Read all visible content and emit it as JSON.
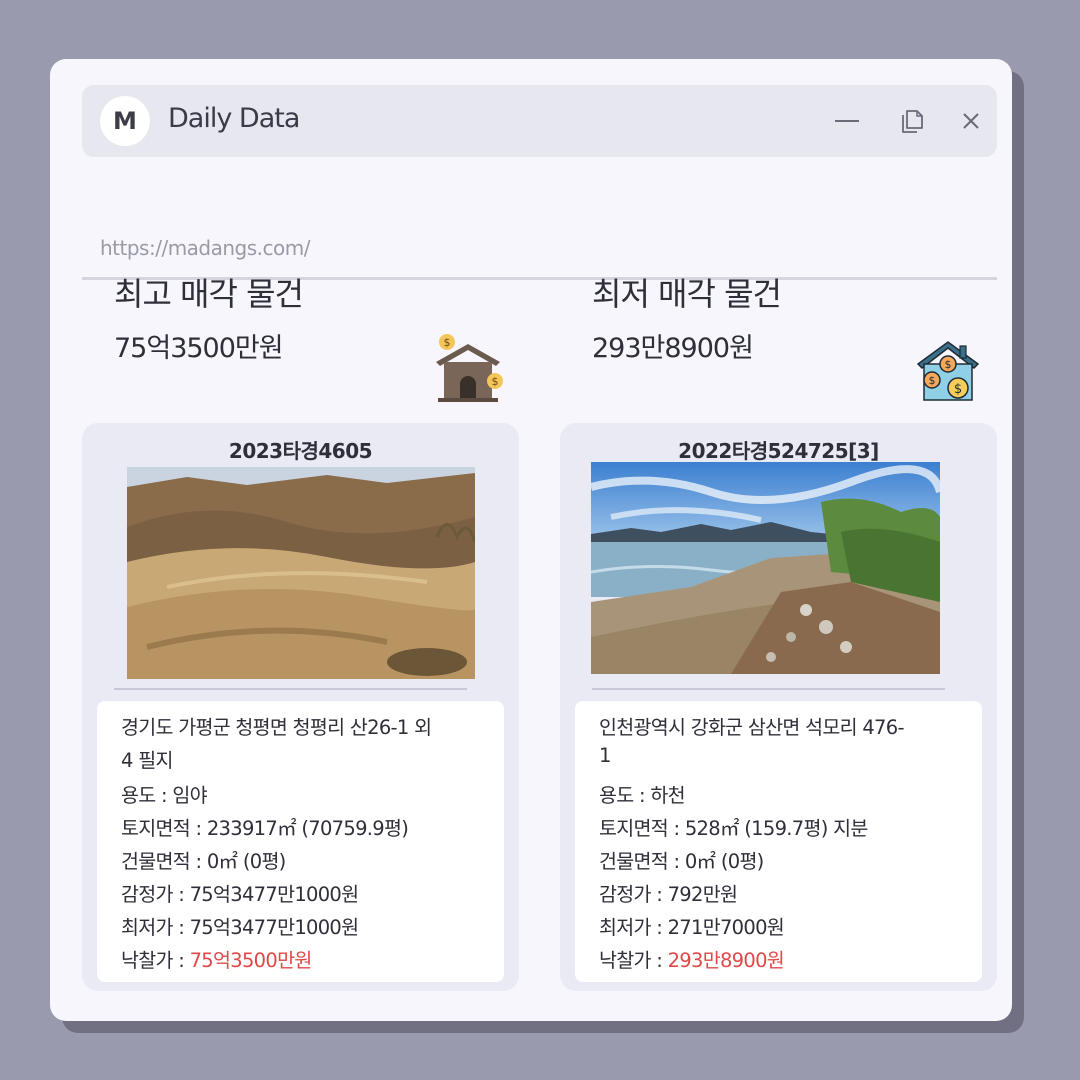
{
  "window": {
    "avatar_letter": "M",
    "title": "Daily Data",
    "url": "https://madangs.com/",
    "controls": [
      "minimize-icon",
      "copy-icon",
      "close-icon"
    ]
  },
  "highest": {
    "title": "최고 매각 물건",
    "value": "75억3500만원",
    "icon": "house-money-icon",
    "card": {
      "case_no": "2023타경4605",
      "address_line1": "경기도 가평군 청평면 청평리 산26-1 외",
      "address_line2": "4 필지",
      "usage_label": "용도 : ",
      "usage": "임야",
      "land_area_label": "토지면적 : ",
      "land_area": "233917㎡ (70759.9평)",
      "building_area_label": "건물면적 : ",
      "building_area": "0㎡ (0평)",
      "appraisal_label": "감정가 : ",
      "appraisal": "75억3477만1000원",
      "minimum_label": "최저가 : ",
      "minimum": "75억3477만1000원",
      "sale_label": "낙찰가 : ",
      "sale_price": "75억3500만원"
    }
  },
  "lowest": {
    "title": "최저 매각 물건",
    "value": "293만8900원",
    "icon": "house-coins-icon",
    "card": {
      "case_no": "2022타경524725[3]",
      "address_line1": "인천광역시 강화군 삼산면 석모리 476-",
      "address_line2": "1",
      "usage_label": "용도 : ",
      "usage": "하천",
      "land_area_label": "토지면적 : ",
      "land_area": "528㎡ (159.7평) 지분",
      "building_area_label": "건물면적 : ",
      "building_area": "0㎡ (0평)",
      "appraisal_label": "감정가 : ",
      "appraisal": "792만원",
      "minimum_label": "최저가 : ",
      "minimum": "271만7000원",
      "sale_label": "낙찰가 : ",
      "sale_price": "293만8900원"
    }
  },
  "colors": {
    "background": "#9a9aae",
    "window": "#f6f6fc",
    "card": "#e9eaf4",
    "price_accent": "#e04848"
  }
}
